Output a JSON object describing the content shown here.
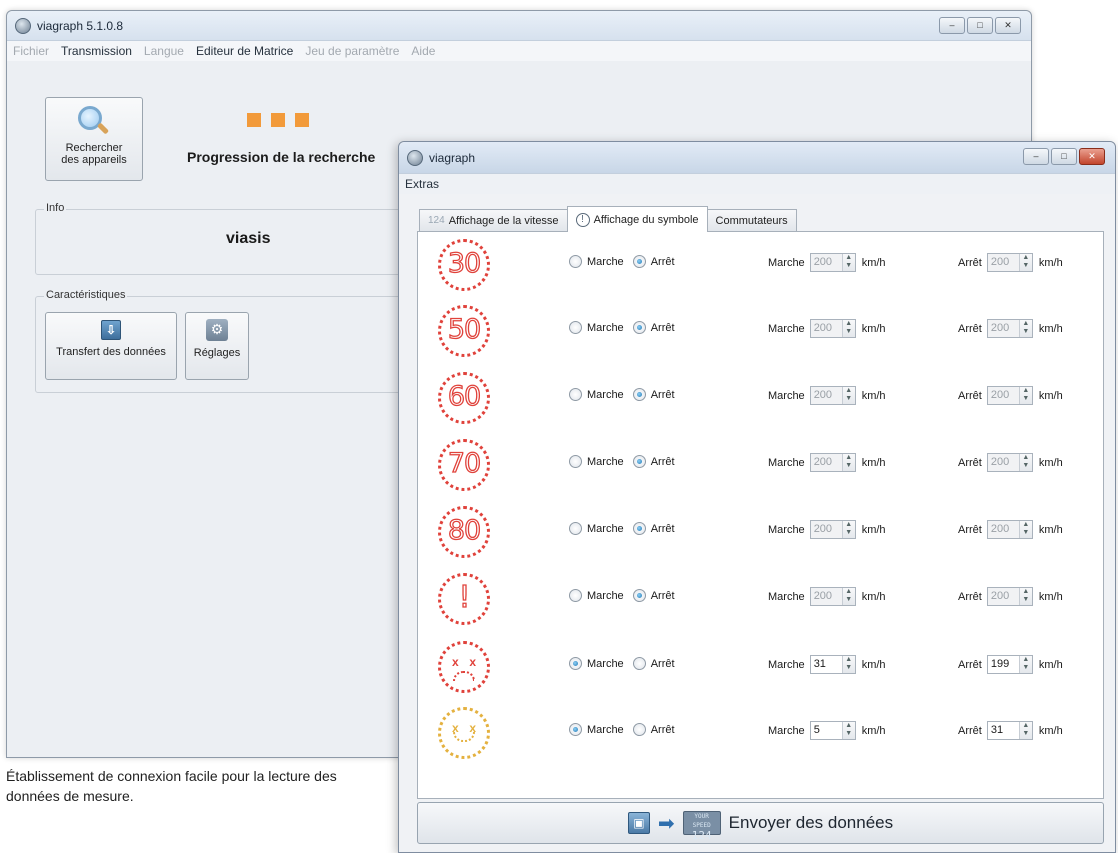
{
  "main_window": {
    "title": "viagraph 5.1.0.8",
    "controls": [
      "–",
      "□",
      "✕"
    ],
    "menu": [
      {
        "label": "Fichier",
        "enabled": false
      },
      {
        "label": "Transmission",
        "enabled": true
      },
      {
        "label": "Langue",
        "enabled": false
      },
      {
        "label": "Editeur de Matrice",
        "enabled": true
      },
      {
        "label": "Jeu de paramètre",
        "enabled": false
      },
      {
        "label": "Aide",
        "enabled": false
      }
    ],
    "search_button": {
      "line1": "Rechercher",
      "line2": "des appareils"
    },
    "progress_label": "Progression de la recherche",
    "info_group": {
      "legend": "Info",
      "device_name": "viasis"
    },
    "characteristics_group": {
      "legend": "Caractéristiques"
    },
    "transfer_button": {
      "label": "Transfert des données"
    },
    "settings_button": {
      "label": "Réglages"
    }
  },
  "caption": "Établissement de connexion facile pour la lecture des données de mesure.",
  "dialog": {
    "title": "viagraph",
    "controls": [
      "–",
      "□",
      "✕"
    ],
    "menu": [
      "Extras"
    ],
    "tabs": [
      {
        "icon_text": "124",
        "label": "Affichage de la vitesse",
        "active": false
      },
      {
        "icon_text": "!",
        "label": "Affichage du symbole",
        "active": true
      },
      {
        "icon_text": "",
        "label": "Commutateurs",
        "active": false
      }
    ],
    "labels": {
      "on": "Marche",
      "off": "Arrêt",
      "unit": "km/h"
    },
    "rows": [
      {
        "symbol": "30",
        "symbol_type": "speed",
        "state": "off",
        "on_value": "200",
        "off_value": "200",
        "enabled": false
      },
      {
        "symbol": "50",
        "symbol_type": "speed",
        "state": "off",
        "on_value": "200",
        "off_value": "200",
        "enabled": false
      },
      {
        "symbol": "60",
        "symbol_type": "speed",
        "state": "off",
        "on_value": "200",
        "off_value": "200",
        "enabled": false
      },
      {
        "symbol": "70",
        "symbol_type": "speed",
        "state": "off",
        "on_value": "200",
        "off_value": "200",
        "enabled": false
      },
      {
        "symbol": "80",
        "symbol_type": "speed",
        "state": "off",
        "on_value": "200",
        "off_value": "200",
        "enabled": false
      },
      {
        "symbol": "!",
        "symbol_type": "warning",
        "state": "off",
        "on_value": "200",
        "off_value": "200",
        "enabled": false
      },
      {
        "symbol": "",
        "symbol_type": "sad-face",
        "state": "on",
        "on_value": "31",
        "off_value": "199",
        "enabled": true
      },
      {
        "symbol": "",
        "symbol_type": "happy-face",
        "state": "on",
        "on_value": "5",
        "off_value": "31",
        "enabled": true
      }
    ],
    "send_button": {
      "label": "Envoyer des données",
      "display_line1": "YOUR SPEED",
      "display_line2": "124"
    }
  },
  "colors": {
    "sign_red": "#e0423b",
    "sign_amber": "#e4b13f",
    "progress_orange": "#f29a3a"
  }
}
